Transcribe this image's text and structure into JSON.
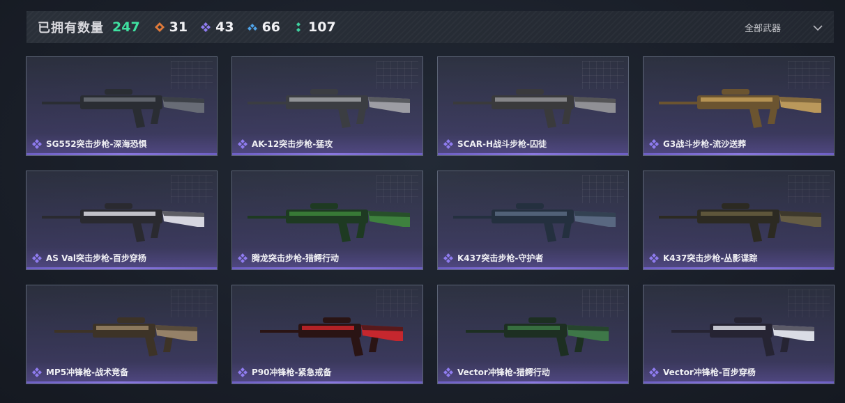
{
  "header": {
    "owned_label": "已拥有数量",
    "owned_count": "247",
    "stats": [
      {
        "icon": "orange-gem-icon",
        "color": "#e07a3a",
        "value": "31"
      },
      {
        "icon": "purple-gem-icon",
        "color": "#8f7cf0",
        "value": "43"
      },
      {
        "icon": "blue-gem-icon",
        "color": "#4fa3e8",
        "value": "66"
      },
      {
        "icon": "green-gem-icon",
        "color": "#3fd2a0",
        "value": "107"
      }
    ],
    "filter_label": "全部武器"
  },
  "colors": {
    "accent_green": "#3fe0a0",
    "rarity_purple": "#8f7cf0"
  },
  "weapons": [
    {
      "name": "SG552突击步枪-深海恐惧",
      "skin": [
        "#2a2d33",
        "#6e727a"
      ]
    },
    {
      "name": "AK-12突击步枪-猛攻",
      "skin": [
        "#3b3d42",
        "#a8a9ad"
      ]
    },
    {
      "name": "SCAR-H战斗步枪-囚徒",
      "skin": [
        "#3a3a3c",
        "#9a9a9c"
      ]
    },
    {
      "name": "G3战斗步枪-流沙送葬",
      "skin": [
        "#6b5430",
        "#c9a35c"
      ]
    },
    {
      "name": "AS Val突击步枪-百步穿杨",
      "skin": [
        "#2a2a30",
        "#e8e8f0"
      ]
    },
    {
      "name": "腾龙突击步枪-猎鳄行动",
      "skin": [
        "#1e3a22",
        "#3f8a3c"
      ]
    },
    {
      "name": "K437突击步枪-守护者",
      "skin": [
        "#24303f",
        "#5d6e86"
      ]
    },
    {
      "name": "K437突击步枪-丛影谍踪",
      "skin": [
        "#2c2a22",
        "#6b6242"
      ]
    },
    {
      "name": "MP5冲锋枪-战术竞备",
      "skin": [
        "#3d3327",
        "#a08a6a"
      ]
    },
    {
      "name": "P90冲锋枪-紧急戒备",
      "skin": [
        "#2a1414",
        "#d6262a"
      ]
    },
    {
      "name": "Vector冲锋枪-猎鳄行动",
      "skin": [
        "#1d2f22",
        "#3f7e47"
      ]
    },
    {
      "name": "Vector冲锋枪-百步穿杨",
      "skin": [
        "#262433",
        "#eceef5"
      ]
    }
  ]
}
